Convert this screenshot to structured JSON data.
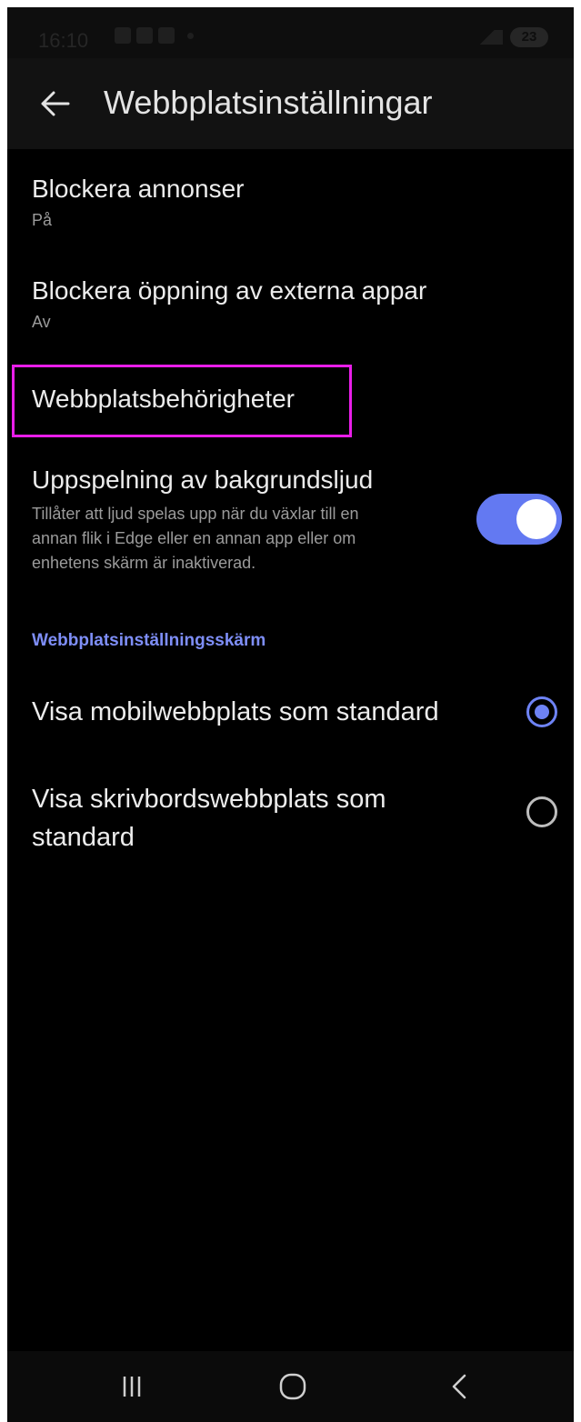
{
  "status_bar": {
    "time": "16:10",
    "battery": "23"
  },
  "app_bar": {
    "title": "Webbplatsinställningar",
    "back_icon": "arrow-left-icon"
  },
  "settings": {
    "block_ads": {
      "title": "Blockera annonser",
      "value": "På"
    },
    "block_external_apps": {
      "title": "Blockera öppning av externa appar",
      "value": "Av"
    },
    "site_permissions": {
      "title": "Webbplatsbehörigheter"
    },
    "background_audio": {
      "title": "Uppspelning av bakgrundsljud",
      "description_lines": [
        "Tillåter att ljud spelas upp när du växlar till en",
        "annan flik i Edge eller en annan app eller om",
        "enhetens skärm är inaktiverad."
      ],
      "enabled": true
    }
  },
  "display_section": {
    "header": "Webbplatsinställningsskärm",
    "options": [
      {
        "lines": [
          "Visa mobilwebbplats som standard"
        ],
        "selected": true
      },
      {
        "lines": [
          "Visa skrivbordswebbplats som",
          "standard"
        ],
        "selected": false
      }
    ]
  },
  "nav_bar": {
    "recents_icon": "recents-icon",
    "home_icon": "home-icon",
    "back_icon": "nav-back-icon"
  },
  "colors": {
    "accent": "#6379f2",
    "highlight": "#e91ee9",
    "background": "#000000"
  }
}
